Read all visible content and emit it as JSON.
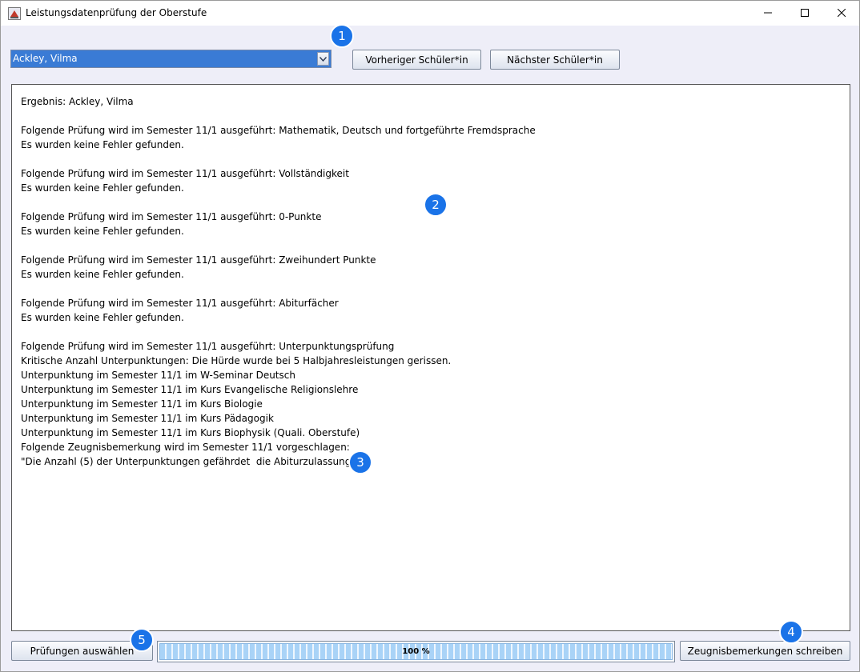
{
  "window": {
    "title": "Leistungsdatenprüfung der Oberstufe"
  },
  "student_select": {
    "selected": "Ackley, Vilma"
  },
  "buttons": {
    "previous": "Vorheriger Schüler*in",
    "next": "Nächster Schüler*in",
    "select_checks": "Prüfungen auswählen",
    "write_remarks": "Zeugnisbemerkungen schreiben"
  },
  "result_lines": [
    "Ergebnis: Ackley, Vilma",
    "",
    "Folgende Prüfung wird im Semester 11/1 ausgeführt: Mathematik, Deutsch und fortgeführte Fremdsprache",
    "Es wurden keine Fehler gefunden.",
    "",
    "Folgende Prüfung wird im Semester 11/1 ausgeführt: Vollständigkeit",
    "Es wurden keine Fehler gefunden.",
    "",
    "Folgende Prüfung wird im Semester 11/1 ausgeführt: 0-Punkte",
    "Es wurden keine Fehler gefunden.",
    "",
    "Folgende Prüfung wird im Semester 11/1 ausgeführt: Zweihundert Punkte",
    "Es wurden keine Fehler gefunden.",
    "",
    "Folgende Prüfung wird im Semester 11/1 ausgeführt: Abiturfächer",
    "Es wurden keine Fehler gefunden.",
    "",
    "Folgende Prüfung wird im Semester 11/1 ausgeführt: Unterpunktungsprüfung",
    "Kritische Anzahl Unterpunktungen: Die Hürde wurde bei 5 Halbjahresleistungen gerissen.",
    "Unterpunktung im Semester 11/1 im W-Seminar Deutsch",
    "Unterpunktung im Semester 11/1 im Kurs Evangelische Religionslehre",
    "Unterpunktung im Semester 11/1 im Kurs Biologie",
    "Unterpunktung im Semester 11/1 im Kurs Pädagogik",
    "Unterpunktung im Semester 11/1 im Kurs Biophysik (Quali. Oberstufe)",
    "Folgende Zeugnisbemerkung wird im Semester 11/1 vorgeschlagen:",
    "\"Die Anzahl (5) der Unterpunktungen gefährdet  die Abiturzulassung.\""
  ],
  "progress": {
    "value": 1.0,
    "label": "100 %"
  },
  "badges": [
    "1",
    "2",
    "3",
    "4",
    "5"
  ],
  "icons": {
    "app": "java-app-icon",
    "combo_arrow": "chevron-down-icon",
    "minimize": "minimize-icon",
    "maximize": "maximize-icon",
    "close": "close-icon"
  },
  "colors": {
    "combo_selected_bg": "#3a7bd5",
    "badge": "#1a73e8",
    "progress_fill": "#a9d3f7"
  }
}
